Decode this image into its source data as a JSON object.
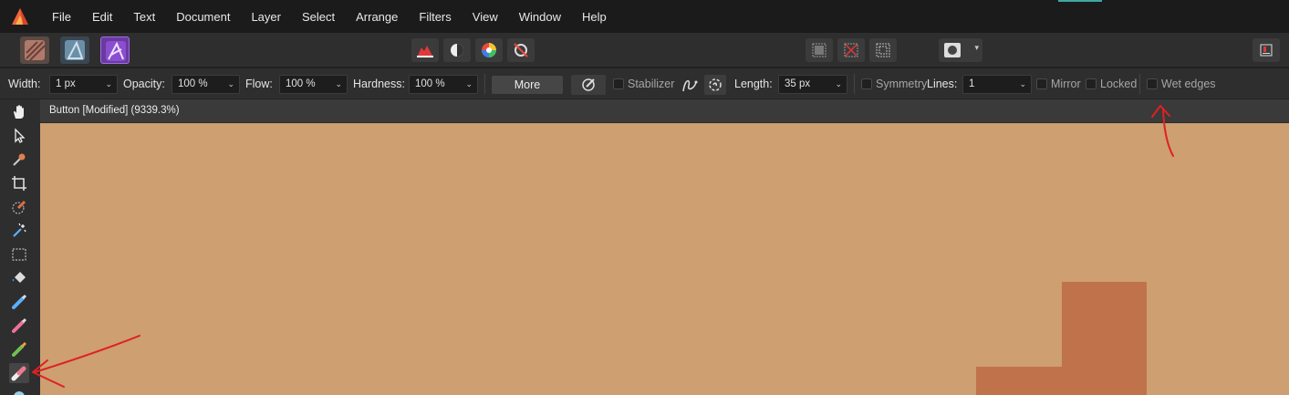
{
  "menu": [
    "File",
    "Edit",
    "Text",
    "Document",
    "Layer",
    "Select",
    "Arrange",
    "Filters",
    "View",
    "Window",
    "Help"
  ],
  "context": {
    "width_label": "Width:",
    "width_value": "1 px",
    "opacity_label": "Opacity:",
    "opacity_value": "100 %",
    "flow_label": "Flow:",
    "flow_value": "100 %",
    "hardness_label": "Hardness:",
    "hardness_value": "100 %",
    "more_label": "More",
    "stabilizer_label": "Stabilizer",
    "length_label": "Length:",
    "length_value": "35 px",
    "symmetry_label": "Symmetry",
    "lines_label": "Lines:",
    "lines_value": "1",
    "mirror_label": "Mirror",
    "locked_label": "Locked",
    "wet_edges_label": "Wet edges"
  },
  "document": {
    "tab_title": "Button [Modified] (9339.3%)"
  },
  "colors": {
    "canvas": "#cd9f71",
    "shape": "#c0734a",
    "annotation": "#e02020"
  }
}
